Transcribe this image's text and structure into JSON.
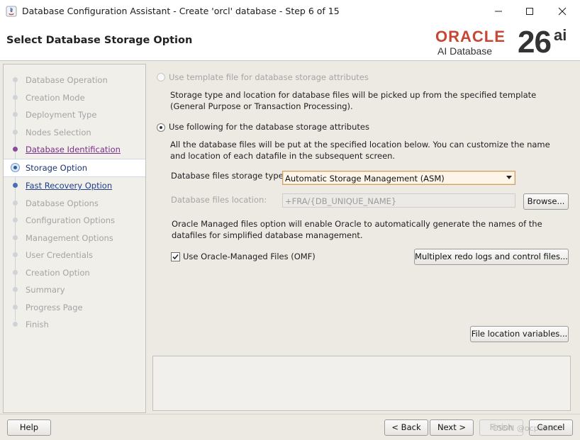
{
  "window": {
    "title": "Database Configuration Assistant - Create 'orcl' database - Step 6 of 15",
    "minimize": "—",
    "maximize": "☐",
    "close": "✕"
  },
  "header": {
    "page_title": "Select Database Storage Option",
    "logo_word": "ORACLE",
    "logo_sub": "AI Database",
    "logo_version": "26",
    "logo_suffix": "ai"
  },
  "steps": [
    {
      "label": "Database Operation",
      "state": "future"
    },
    {
      "label": "Creation Mode",
      "state": "future"
    },
    {
      "label": "Deployment Type",
      "state": "future"
    },
    {
      "label": "Nodes Selection",
      "state": "future"
    },
    {
      "label": "Database Identification",
      "state": "done"
    },
    {
      "label": "Storage Option",
      "state": "current"
    },
    {
      "label": "Fast Recovery Option",
      "state": "next"
    },
    {
      "label": "Database Options",
      "state": "future"
    },
    {
      "label": "Configuration Options",
      "state": "future"
    },
    {
      "label": "Management Options",
      "state": "future"
    },
    {
      "label": "User Credentials",
      "state": "future"
    },
    {
      "label": "Creation Option",
      "state": "future"
    },
    {
      "label": "Summary",
      "state": "future"
    },
    {
      "label": "Progress Page",
      "state": "future"
    },
    {
      "label": "Finish",
      "state": "future"
    }
  ],
  "storage": {
    "template_option": {
      "label": "Use template file for database storage attributes",
      "description": "Storage type and location for database files will be picked up from the specified template (General Purpose or Transaction Processing).",
      "selected": false,
      "enabled": false
    },
    "custom_option": {
      "label": "Use following for the database storage attributes",
      "description": "All the database files will be put at the specified location below. You can customize the name and location of each datafile in the subsequent screen.",
      "selected": true
    },
    "storage_type_label": "Database files storage type:",
    "storage_type_value": "Automatic Storage Management (ASM)",
    "location_label": "Database files location:",
    "location_value": "+FRA/{DB_UNIQUE_NAME}",
    "browse_label": "Browse...",
    "omf_description": "Oracle Managed files option will enable Oracle to automatically generate the names of the datafiles for simplified database management.",
    "omf_label": "Use Oracle-Managed Files (OMF)",
    "omf_checked": true,
    "multiplex_label": "Multiplex redo logs and control files...",
    "file_location_vars_label": "File location variables..."
  },
  "footer": {
    "help": "Help",
    "back": "< Back",
    "next": "Next >",
    "finish": "Finish",
    "cancel": "Cancel",
    "watermark": "CSDN @ocpassin"
  },
  "colors": {
    "oracle_red": "#c74634",
    "panel_bg": "#edeae4",
    "done_step": "#7a2e8a",
    "next_step": "#1e3f8c"
  }
}
